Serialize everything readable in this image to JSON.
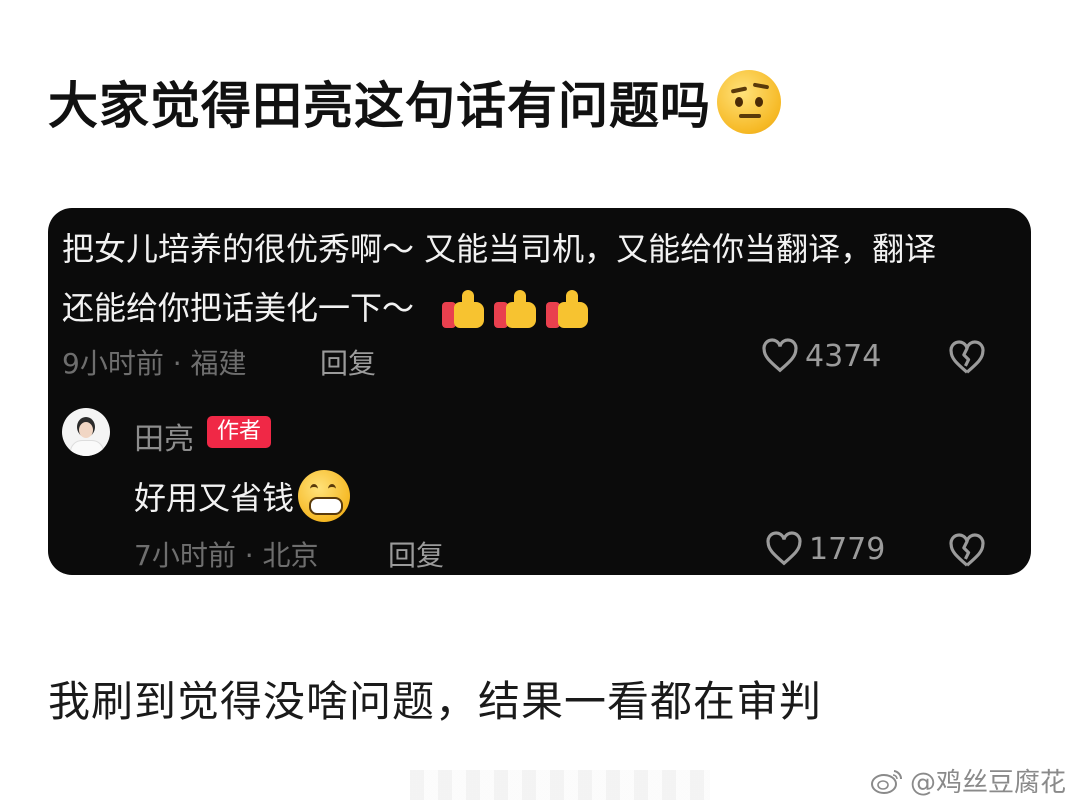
{
  "post": {
    "headline": "大家觉得田亮这句话有问题吗",
    "headline_emoji": "thinking-face-icon",
    "caption": "我刷到觉得没啥问题，结果一看都在审判",
    "watermark": "@鸡丝豆腐花"
  },
  "comment": {
    "text": "把女儿培养的很优秀啊～ 又能当司机，又能给你当翻译，翻译还能给你把话美化一下～",
    "emojis": [
      "thumbs-up-icon",
      "thumbs-up-icon",
      "thumbs-up-icon"
    ],
    "meta": "9小时前 · 福建",
    "reply_label": "回复",
    "likes": "4374"
  },
  "reply": {
    "author": "田亮",
    "badge": "作者",
    "text": "好用又省钱",
    "emoji": "grinning-face-icon",
    "meta": "7小时前 · 北京",
    "reply_label": "回复",
    "likes": "1779"
  },
  "colors": {
    "card_bg": "#0b0b0b",
    "badge": "#f02846",
    "meta_text": "#6e6e6e"
  }
}
